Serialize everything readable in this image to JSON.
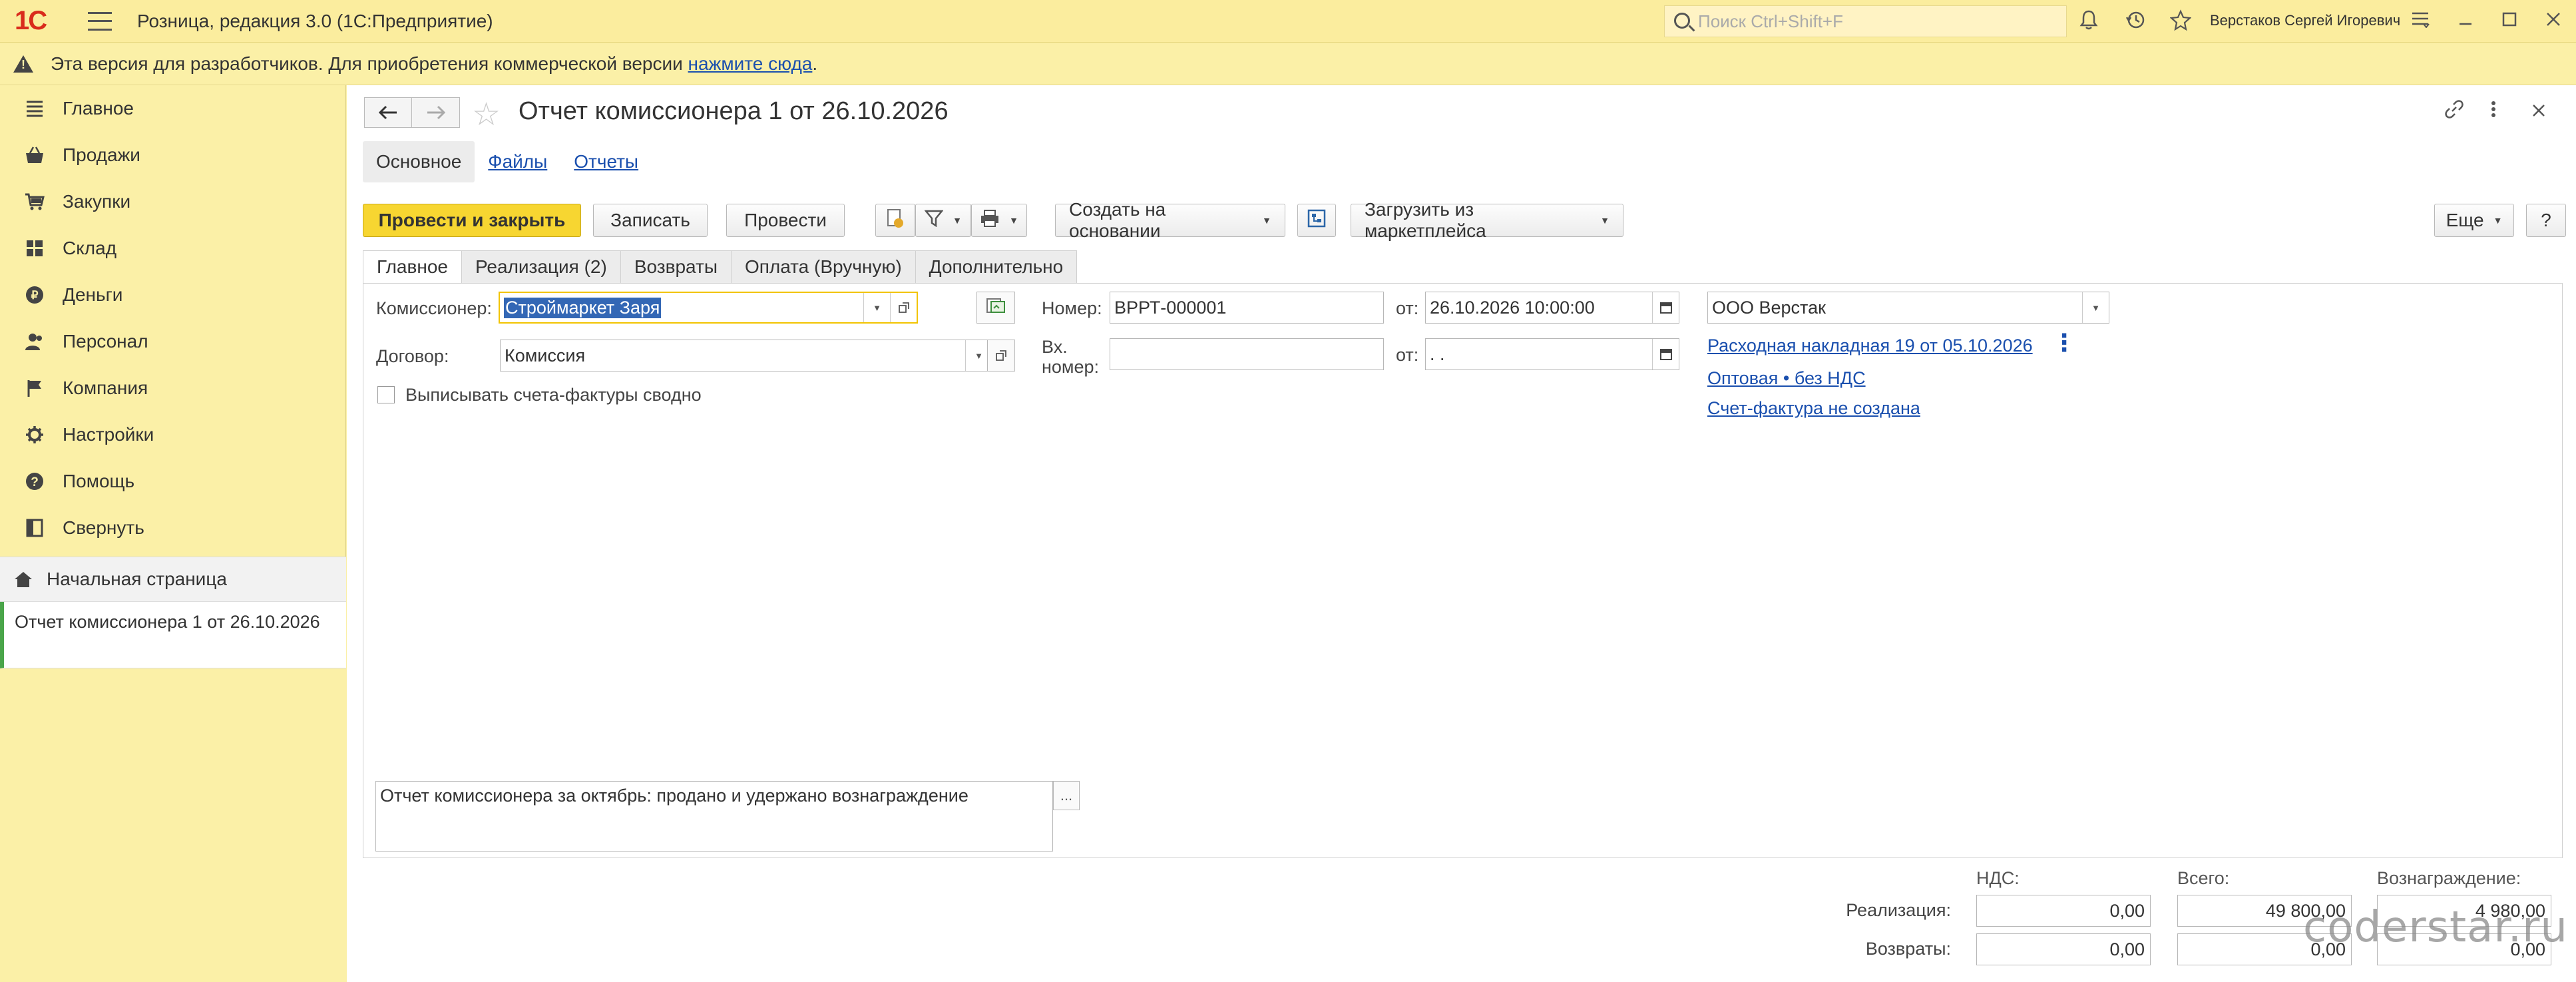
{
  "titlebar": {
    "logo": "1С",
    "app_title": "Розница, редакция 3.0  (1С:Предприятие)",
    "search_placeholder": "Поиск Ctrl+Shift+F",
    "user": "Верстаков Сергей Игоревич"
  },
  "infobar": {
    "text": "Эта версия для разработчиков. Для приобретения коммерческой версии ",
    "link": "нажмите сюда",
    "tail": "."
  },
  "sidebar": {
    "items": [
      {
        "label": "Главное",
        "icon": "menu-icon"
      },
      {
        "label": "Продажи",
        "icon": "basket-icon"
      },
      {
        "label": "Закупки",
        "icon": "cart-icon"
      },
      {
        "label": "Склад",
        "icon": "warehouse-icon"
      },
      {
        "label": "Деньги",
        "icon": "coin-icon"
      },
      {
        "label": "Персонал",
        "icon": "people-icon"
      },
      {
        "label": "Компания",
        "icon": "flag-icon"
      },
      {
        "label": "Настройки",
        "icon": "gear-icon"
      },
      {
        "label": "Помощь",
        "icon": "help-icon"
      },
      {
        "label": "Свернуть",
        "icon": "collapse-icon"
      }
    ],
    "home": "Начальная страница",
    "open_doc": "Отчет комиссионера 1 от 26.10.2026"
  },
  "document": {
    "title": "Отчет комиссионера 1 от 26.10.2026",
    "section_tabs": [
      "Основное",
      "Файлы",
      "Отчеты"
    ],
    "toolbar": {
      "post_close": "Провести и закрыть",
      "save": "Записать",
      "post": "Провести",
      "create_based": "Создать на основании",
      "load_marketplace": "Загрузить из маркетплейса",
      "more": "Еще",
      "help": "?"
    },
    "form_tabs": [
      "Главное",
      "Реализация (2)",
      "Возвраты",
      "Оплата (Вручную)",
      "Дополнительно"
    ],
    "fields": {
      "commissioner_label": "Комиссионер:",
      "commissioner_value": "Строймаркет Заря",
      "contract_label": "Договор:",
      "contract_value": "Комиссия",
      "invoice_summary_label": "Выписывать счета-фактуры сводно",
      "number_label": "Номер:",
      "number_value": "ВРРТ-000001",
      "date_label": "от:",
      "date_value": "26.10.2026 10:00:00",
      "in_number_label": "Вх. номер:",
      "in_number_value": "",
      "in_date_label": "от:",
      "in_date_value": " .  .",
      "organization": "ООО Верстак",
      "link_invoice": "Расходная накладная 19 от 05.10.2026",
      "link_price": "Оптовая • без НДС",
      "link_sf": "Счет-фактура не создана",
      "comment": "Отчет комиссионера за октябрь: продано и удержано вознаграждение",
      "comment_btn": "..."
    },
    "totals": {
      "headers": {
        "vat": "НДС:",
        "total": "Всего:",
        "reward": "Вознаграждение:"
      },
      "rows": [
        {
          "label": "Реализация:",
          "vat": "0,00",
          "total": "49 800,00",
          "reward": "4 980,00"
        },
        {
          "label": "Возвраты:",
          "vat": "0,00",
          "total": "0,00",
          "reward": "0,00"
        }
      ]
    }
  },
  "watermark": "coderstar.ru",
  "colors": {
    "accent": "#f7d631",
    "sidebar": "#fbf0a7",
    "link": "#1a4fae"
  }
}
